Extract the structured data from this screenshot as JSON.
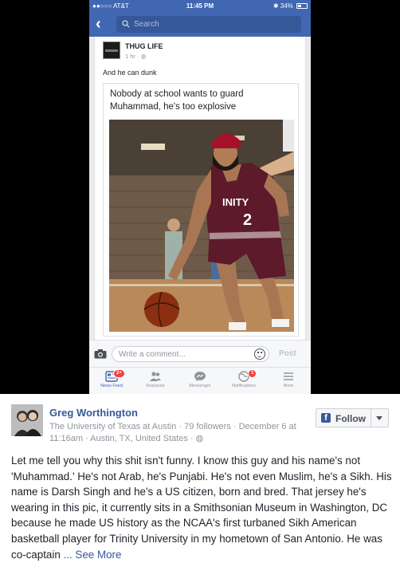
{
  "status_bar": {
    "carrier": "●●○○○ AT&T",
    "time": "11:45 PM",
    "battery": "34%"
  },
  "navbar": {
    "search_placeholder": "Search"
  },
  "post": {
    "author": "THUG LIFE",
    "time": "1 hr · ",
    "text": "And he can dunk",
    "shared_caption": "Nobody at school wants to guard Muhammad, he's too explosive",
    "photo_jersey_text": "INITY",
    "photo_jersey_number": "2"
  },
  "comment_bar": {
    "placeholder": "Write a comment...",
    "post_label": "Post"
  },
  "tabs": [
    {
      "label": "News Feed",
      "badge": "2+"
    },
    {
      "label": "Requests"
    },
    {
      "label": "Messenger"
    },
    {
      "label": "Notifications",
      "badge": "1"
    },
    {
      "label": "More"
    }
  ],
  "outer_post": {
    "name": "Greg Worthington",
    "meta_line": "The University of Texas at Austin · 79 followers · December 6 at 11:16am · Austin, TX, United States · ",
    "follow_label": "Follow",
    "body": "Let me tell you why this shit isn't funny. I know this guy and his name's not 'Muhammad.' He's not Arab, he's Punjabi. He's not even Muslim, he's a Sikh. His name is Darsh Singh and he's a US citizen, born and bred. That jersey he's wearing in this pic, it currently sits in a Smithsonian Museum in Washington, DC because he made US history as the NCAA's first turbaned Sikh American basketball player for Trinity University in my hometown of San Antonio. He was co-captain ",
    "see_more": "... See More"
  },
  "colors": {
    "facebook_blue": "#4267b2",
    "link_blue": "#365899",
    "badge_red": "#fa3e3e",
    "jersey_maroon": "#5c1a2b",
    "turban_red": "#a3122a"
  },
  "icons": [
    "back-chevron-icon",
    "search-icon",
    "wifi-icon",
    "bluetooth-icon",
    "battery-icon",
    "globe-icon",
    "camera-icon",
    "smiley-icon",
    "news-feed-icon",
    "requests-icon",
    "messenger-icon",
    "notifications-icon",
    "more-icon",
    "facebook-f-icon",
    "caret-down-icon"
  ]
}
